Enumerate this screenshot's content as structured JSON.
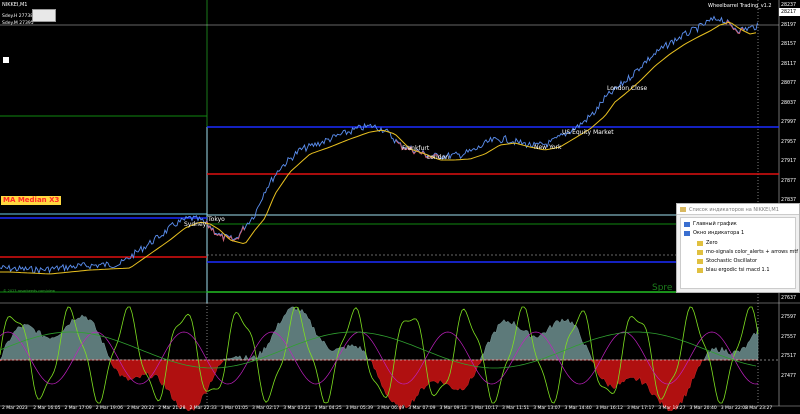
{
  "chart": {
    "symbol_line": "NIKKEI,M1",
    "ticket_bid": "Sdey.H 27738",
    "ticket_ask": "Sdey.M 27395",
    "indicator_title": "Wheelbarrel Trading_v1.2",
    "ma_label": "MA Median X3",
    "spread_label": "Spre",
    "bottom_note": "© 2023 rosarbeeds.com/view",
    "session_labels": [
      "Sydney",
      "Frankfurt",
      "London",
      "New York",
      "US Equity Market",
      "London Close",
      "Tokyo"
    ],
    "price_ticks": [
      "28237",
      "28197",
      "28157",
      "28117",
      "28077",
      "28037",
      "27997",
      "27957",
      "27917",
      "27877",
      "27837",
      "27797",
      "27757",
      "27717",
      "27677",
      "27637",
      "27597",
      "27557",
      "27517",
      "27477"
    ],
    "current_price": "28217",
    "time_ticks": [
      "2 Mar 2023",
      "2 Mar 16:05",
      "2 Mar 17:09",
      "2 Mar 19:06",
      "2 Mar 20:22",
      "2 Mar 21:28",
      "2 Mar 22:33",
      "3 Mar 01:05",
      "3 Mar 02:17",
      "3 Mar 03:21",
      "3 Mar 04:25",
      "3 Mar 05:39",
      "3 Mar 06:49",
      "3 Mar 07:09",
      "3 Mar 09:13",
      "3 Mar 10:17",
      "3 Mar 11:51",
      "3 Mar 13:07",
      "3 Mar 14:40",
      "3 Mar 16:12",
      "3 Mar 17:17",
      "3 Mar 19:27",
      "3 Mar 20:40",
      "3 Mar 22:08",
      "3 Mar 23:27"
    ],
    "colors": {
      "price": "#5b8ff0",
      "ma": "#e8c020",
      "blue_level": "#1a2cff",
      "red_level": "#e01010",
      "green_level": "#118811",
      "cyan_level": "#a0e0f0",
      "histo_pos": "#5d7a7a",
      "histo_neg": "#b01010"
    }
  },
  "indicators_window": {
    "title": "Список индикаторов на NIKKEI,M1",
    "main_chart": "Главный график",
    "sub_window": "Окно индикатора 1",
    "items": [
      "Zero",
      "mo-signals color_alerts + arrows mtf",
      "Stochastic Oscillator",
      "blau ergodic tsi macd 1.1"
    ]
  }
}
